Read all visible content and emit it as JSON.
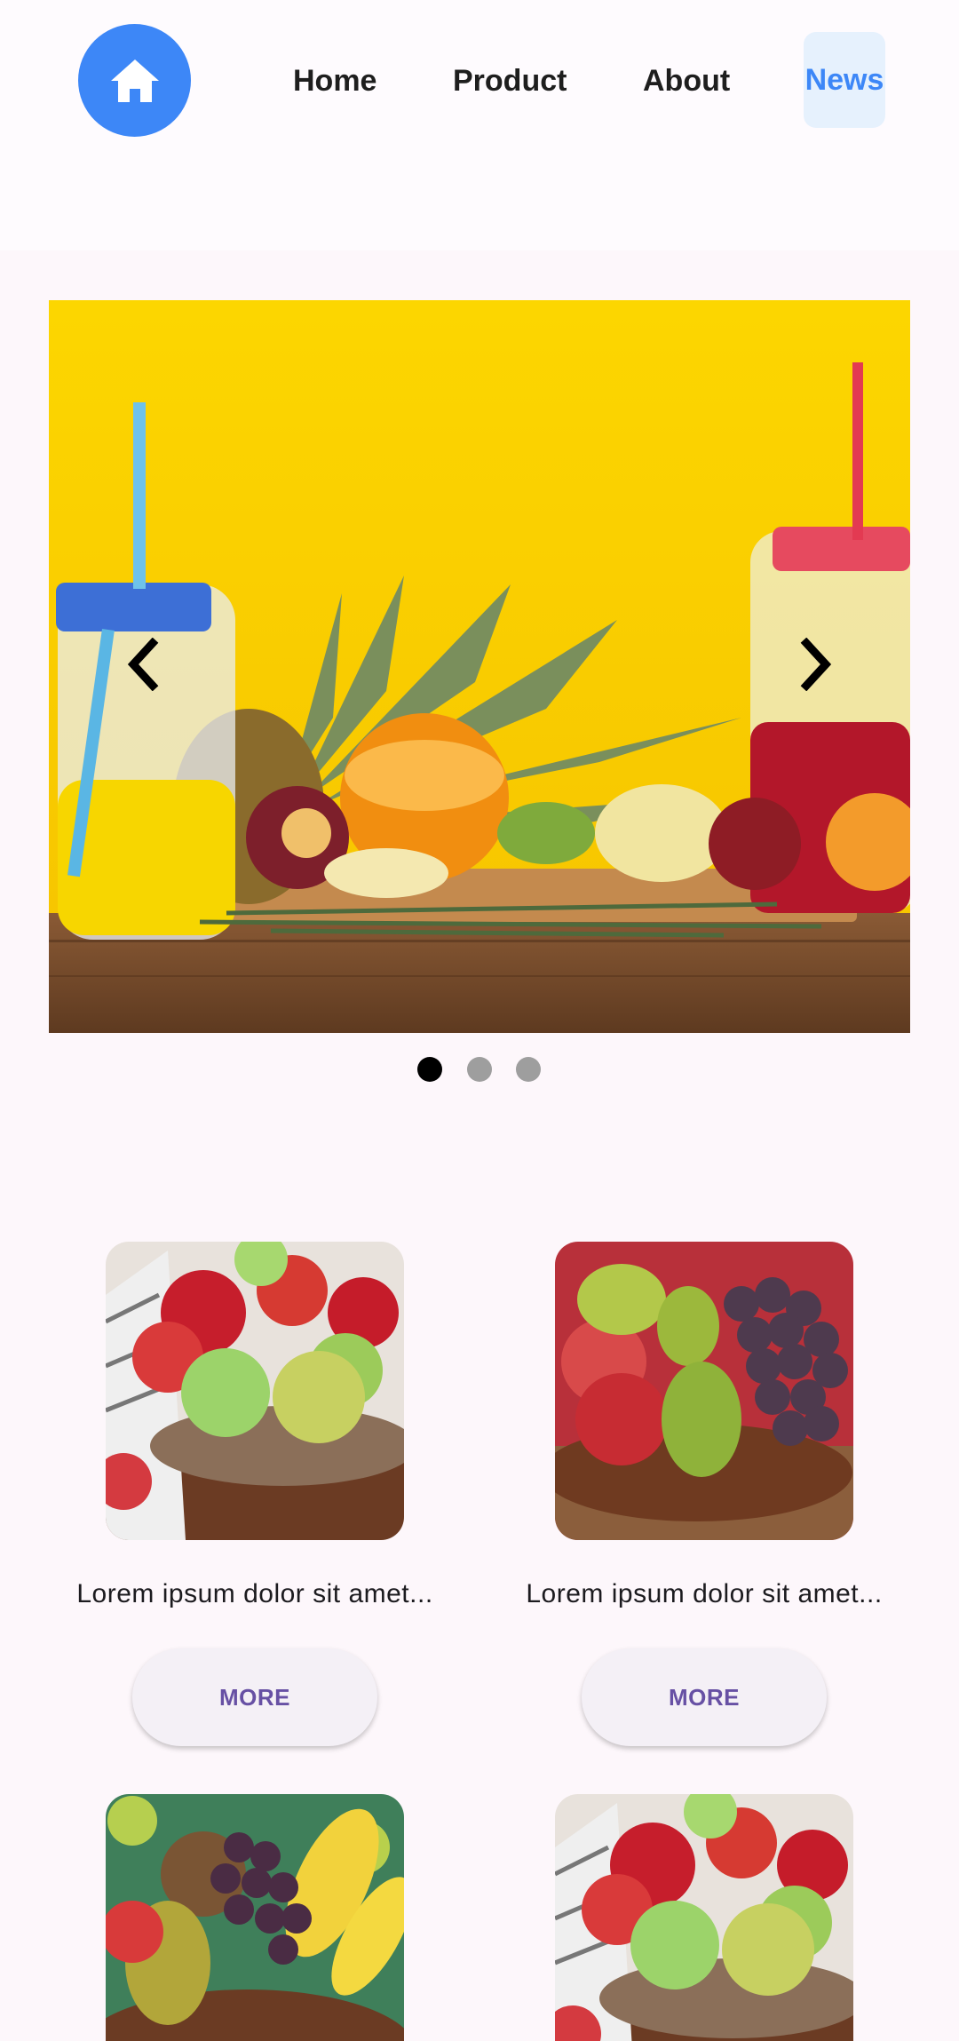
{
  "nav": {
    "items": [
      {
        "label": "Home"
      },
      {
        "label": "Product"
      },
      {
        "label": "About"
      },
      {
        "label": "News",
        "active": true
      }
    ],
    "home_icon": "home-icon",
    "accent_color": "#3d87f7",
    "active_bg": "#e6f1fd"
  },
  "carousel": {
    "slide_count": 3,
    "active_index": 0,
    "prev_icon": "chevron-left-icon",
    "next_icon": "chevron-right-icon"
  },
  "products": [
    {
      "title": "Lorem ipsum dolor sit amet...",
      "button": "MORE"
    },
    {
      "title": "Lorem ipsum dolor sit amet...",
      "button": "MORE"
    },
    {
      "title": "",
      "button": ""
    },
    {
      "title": "",
      "button": ""
    }
  ],
  "colors": {
    "background": "#fdf7fb",
    "button_text": "#6750a4",
    "button_bg": "#f4f0f6"
  }
}
